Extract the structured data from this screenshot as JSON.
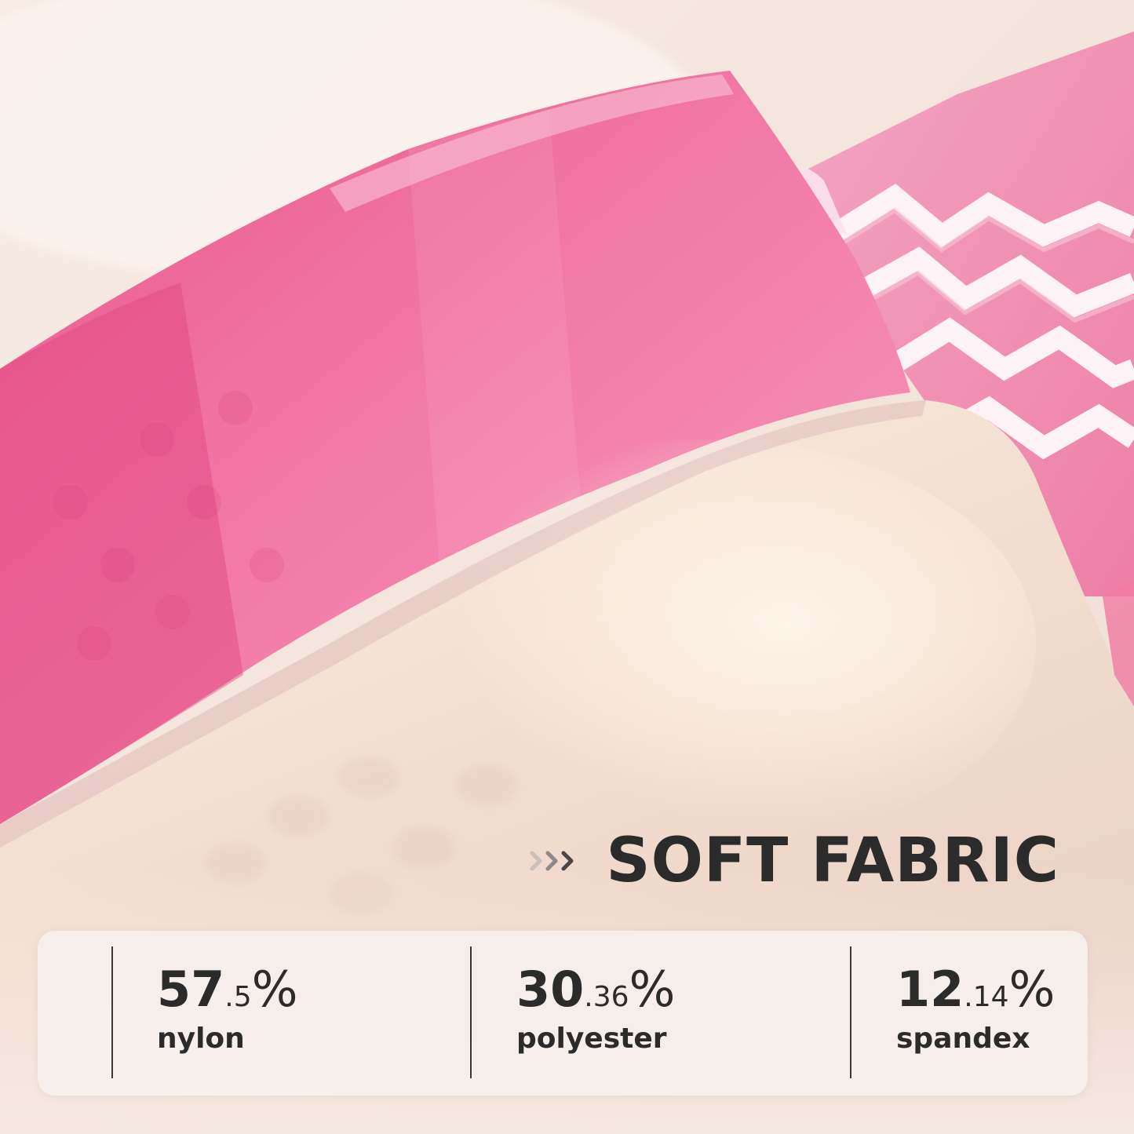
{
  "headline": {
    "text": "SOFT FABRIC",
    "arrow_icon": "triple-chevron-right-icon"
  },
  "stats": [
    {
      "int": "57",
      "dec": ".5",
      "pct": "%",
      "label": "nylon"
    },
    {
      "int": "30",
      "dec": ".36",
      "pct": "%",
      "label": "polyester"
    },
    {
      "int": "12",
      "dec": ".14",
      "pct": "%",
      "label": "spandex"
    }
  ],
  "colors": {
    "pink": "#f07aa3",
    "cream": "#f5e2d6",
    "text": "#2c2b2b"
  }
}
